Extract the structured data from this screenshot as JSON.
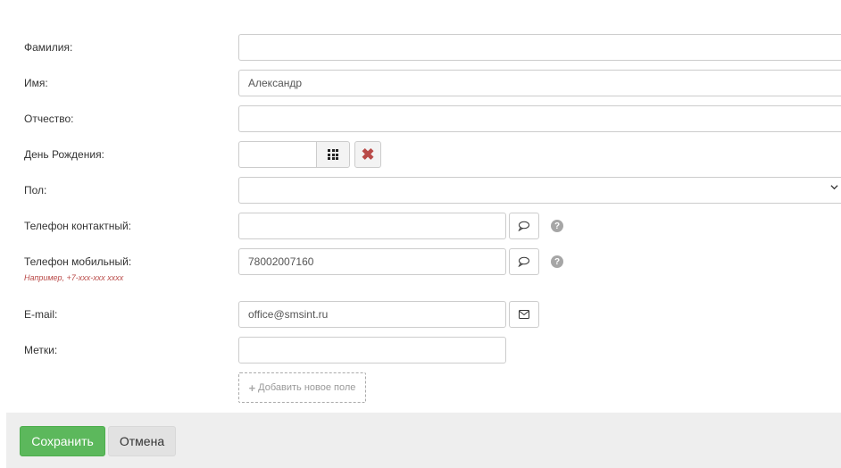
{
  "form": {
    "surname": {
      "label": "Фамилия:",
      "value": ""
    },
    "name": {
      "label": "Имя:",
      "value": "Александр"
    },
    "patronymic": {
      "label": "Отчество:",
      "value": ""
    },
    "birthday": {
      "label": "День Рождения:",
      "value": "",
      "calendar_icon": "calendar-grid-icon",
      "clear_icon": "clear-x-icon"
    },
    "gender": {
      "label": "Пол:",
      "selected": "",
      "icon": "chevron-down-icon"
    },
    "phone_contact": {
      "label": "Телефон контактный:",
      "value": "",
      "action_icon": "speech-bubble-icon",
      "help_icon": "help-icon"
    },
    "phone_mobile": {
      "label": "Телефон мобильный:",
      "hint": "Например, +7-xxx-xxx xxxx",
      "value": "78002007160",
      "action_icon": "speech-bubble-icon",
      "help_icon": "help-icon"
    },
    "email": {
      "label": "E-mail:",
      "value": "office@smsint.ru",
      "action_icon": "envelope-icon"
    },
    "tags": {
      "label": "Метки:",
      "value": ""
    },
    "add_field": {
      "label": "Добавить новое поле",
      "icon": "plus-icon"
    }
  },
  "footer": {
    "save_label": "Сохранить",
    "cancel_label": "Отмена"
  },
  "colors": {
    "save_button": "#5cb85c",
    "clear_icon": "#b94a48",
    "hint_text": "#b94a48",
    "footer_background": "#eeeeee"
  }
}
